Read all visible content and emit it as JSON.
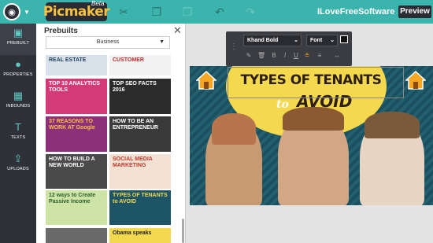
{
  "topbar": {
    "brand": "Picmaker",
    "beta": "Beta",
    "site": "ILoveFreeSoftware",
    "preview": "Preview",
    "tools": [
      "scissors-icon",
      "copy-icon",
      "paste-icon",
      "undo-icon",
      "redo-icon"
    ]
  },
  "leftnav": {
    "items": [
      {
        "label": "PREBUILT",
        "icon": "prebuilt-icon"
      },
      {
        "label": "PROPERTIES",
        "icon": "bulb-icon"
      },
      {
        "label": "INBOUNDS",
        "icon": "grid-icon"
      },
      {
        "label": "TEXTS",
        "icon": "text-icon"
      },
      {
        "label": "UPLOADS",
        "icon": "upload-icon"
      }
    ]
  },
  "panel": {
    "title": "Prebuilts",
    "category": "Business",
    "thumbs": [
      {
        "text": "REAL ESTATE",
        "bg": "#d9e2ea",
        "fg": "#1d3e5a"
      },
      {
        "text": "CUSTOMER",
        "bg": "#f2f2f2",
        "fg": "#c12b2b"
      },
      {
        "text": "TOP 10 ANALYTICS TOOLS",
        "bg": "#d33b78",
        "fg": "#ffffff"
      },
      {
        "text": "TOP SEO FACTS 2016",
        "bg": "#2b2b2b",
        "fg": "#ffffff"
      },
      {
        "text": "37 REASONS TO WORK AT Google",
        "bg": "#8e2f7a",
        "fg": "#f6c141"
      },
      {
        "text": "HOW TO BE AN ENTREPRENEUR",
        "bg": "#3a3a3a",
        "fg": "#ffffff"
      },
      {
        "text": "HOW TO BUILD A NEW WORLD",
        "bg": "#4a4a4a",
        "fg": "#ffffff"
      },
      {
        "text": "SOCIAL MEDIA MARKETING",
        "bg": "#f3e2d4",
        "fg": "#c0392b"
      },
      {
        "text": "12 ways to Create Passive Income",
        "bg": "#cde4a6",
        "fg": "#2b5f2b"
      },
      {
        "text": "TYPES OF TENANTS to AVOID",
        "bg": "#1e5566",
        "fg": "#f4d94e"
      },
      {
        "text": "",
        "bg": "#6a6a6a",
        "fg": "#ffffff"
      },
      {
        "text": "Obama speaks",
        "bg": "#f4d94e",
        "fg": "#222222"
      }
    ]
  },
  "toolbar": {
    "font": "Khand Bold",
    "size": "Font",
    "color": "#111111"
  },
  "design": {
    "title": "TYPES OF TENANTS",
    "to": "to",
    "avoid": "AVOID"
  }
}
